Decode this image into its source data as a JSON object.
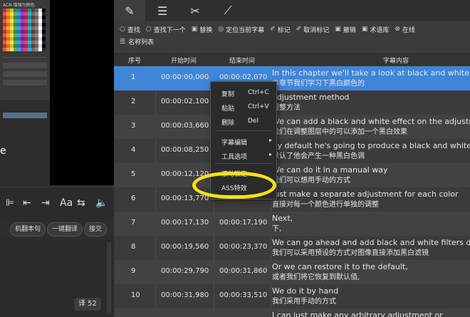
{
  "left": {
    "ps_title": "ACN 增强为颜色",
    "canvas_letter": "e",
    "tool_glyphs": [
      "⊫",
      "⇤",
      "⇥",
      "Aa",
      "⇆",
      "🔈"
    ],
    "buttons": [
      "机翻本句",
      "一键翻译",
      "接交"
    ],
    "count_badge": "译 52"
  },
  "tabs": [
    {
      "icon": "pencil-icon",
      "glyph": "✎"
    },
    {
      "icon": "list-icon",
      "glyph": "☰"
    },
    {
      "icon": "tools-icon",
      "glyph": "✂"
    },
    {
      "icon": "chart-icon",
      "glyph": "⟋"
    }
  ],
  "toolbar": [
    {
      "icon": "search-icon",
      "glyph": "○",
      "label": "查找"
    },
    {
      "icon": "find-next-icon",
      "glyph": "○",
      "label": "查找下一个"
    },
    {
      "icon": "replace-icon",
      "glyph": "▣",
      "label": "替换"
    },
    {
      "icon": "locate-icon",
      "glyph": "◎",
      "label": "定位当前字幕"
    },
    {
      "icon": "pin-icon",
      "glyph": "✐",
      "label": "标记"
    },
    {
      "icon": "unpin-icon",
      "glyph": "✐",
      "label": "取消标记"
    },
    {
      "icon": "undo-icon",
      "glyph": "▣",
      "label": "撤销"
    },
    {
      "icon": "term-icon",
      "glyph": "▣",
      "label": "术语库"
    },
    {
      "icon": "settings-icon",
      "glyph": "⊗",
      "label": "在线"
    }
  ],
  "list_name": {
    "icon": "list-icon",
    "glyph": "☰",
    "label": "名称列表"
  },
  "columns": [
    "序号",
    "开始时间",
    "结束时间",
    "字幕内容"
  ],
  "rows": [
    {
      "num": "1",
      "start": "00:00:00,000",
      "end": "00:00:02,070",
      "en": "In this chapter we'll take a look at black and white",
      "zh": "本章节我们学习下黑白颜色的"
    },
    {
      "num": "2",
      "start": "00:00:02,100",
      "end": "",
      "en": "adjustment method",
      "zh": "调整方法"
    },
    {
      "num": "3",
      "start": "00:00:03,660",
      "end": "",
      "en": "We can add a black and white effect on the adjustm",
      "zh": "我们在调整图层中的可以添加一个黑白效果"
    },
    {
      "num": "4",
      "start": "00:00:08,250",
      "end": "",
      "en": "By default he's going to produce a black and white c",
      "zh": "默认了他会产生一种黑白色调"
    },
    {
      "num": "5",
      "start": "00:00:12,120",
      "end": "",
      "en": "We can do it in a manual way",
      "zh": "我们可以想用手动的方式"
    },
    {
      "num": "6",
      "start": "00:00:13,770",
      "end": "",
      "en": "Just make a separate adjustment for each color",
      "zh": "直接对每一个颜色进行单独的调整"
    },
    {
      "num": "7",
      "start": "00:00:17,130",
      "end": "00:00:17,190",
      "en": "Next,",
      "zh": "下,"
    },
    {
      "num": "8",
      "start": "00:00:19,560",
      "end": "00:00:23,370",
      "en": "We can go ahead and add black and white filters dire",
      "zh": "我们可以采用预设的方式对图像直接添加黑白滤镜"
    },
    {
      "num": "9",
      "start": "00:00:29,790",
      "end": "00:00:31,860",
      "en": "Or we can restore it to the default,",
      "zh": "或者我们将它恢复到默认值,"
    },
    {
      "num": "10",
      "start": "00:00:31,980",
      "end": "00:00:33,510",
      "en": "We do it by hand",
      "zh": "我们采用手动的方式"
    },
    {
      "num": "",
      "start": "",
      "end": "",
      "en": "I can just make any arbitrary adjustment or",
      "zh": ""
    }
  ],
  "context_menu": {
    "items": [
      {
        "label": "复制",
        "shortcut": "Ctrl+C"
      },
      {
        "label": "粘贴",
        "shortcut": "Ctrl+V"
      },
      {
        "label": "删除",
        "shortcut": "Del"
      },
      {
        "label": "字幕编辑",
        "submenu": "▸"
      },
      {
        "label": "工具选项",
        "submenu": "▸"
      },
      {
        "label": "滚动锁定"
      },
      {
        "label": "ASS特效"
      }
    ]
  }
}
